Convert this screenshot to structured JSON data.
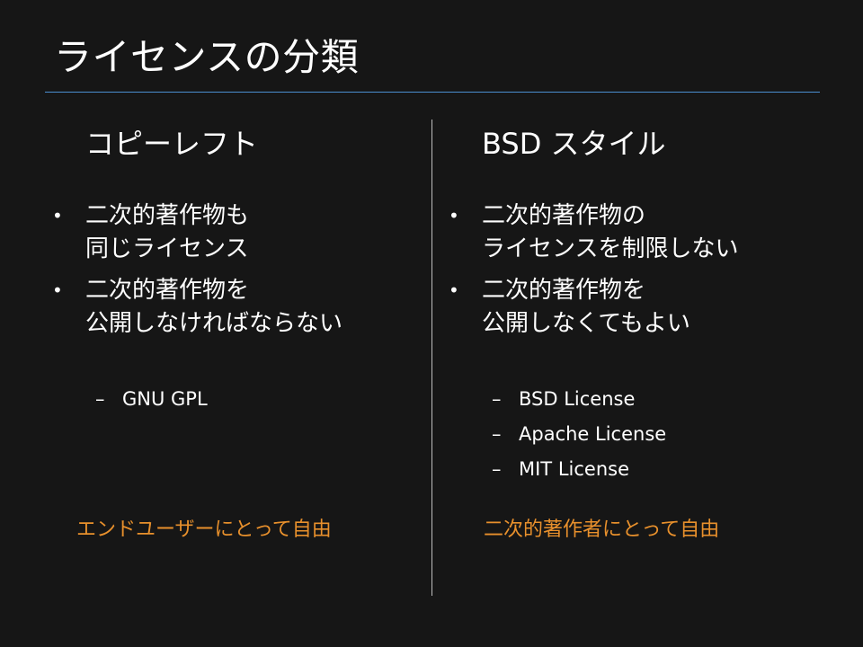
{
  "slide": {
    "title": "ライセンスの分類"
  },
  "columns": [
    {
      "heading": "コピーレフト",
      "bullets": [
        {
          "lines": [
            "二次的著作物も",
            "同じライセンス"
          ]
        },
        {
          "lines": [
            "二次的著作物を",
            "公開しなければならない"
          ]
        }
      ],
      "sub_items": [
        "GNU GPL"
      ],
      "note": "エンドユーザーにとって自由"
    },
    {
      "heading": "BSD スタイル",
      "bullets": [
        {
          "lines": [
            "二次的著作物の",
            "ライセンスを制限しない"
          ]
        },
        {
          "lines": [
            "二次的著作物を",
            "公開しなくてもよい"
          ]
        }
      ],
      "sub_items": [
        "BSD License",
        "Apache License",
        "MIT License"
      ],
      "note": "二次的著作者にとって自由"
    }
  ],
  "symbols": {
    "bullet": "•",
    "dash": "–"
  },
  "colors": {
    "background": "#161616",
    "text": "#ffffff",
    "accent": "#e8902c",
    "rule": "#4a8fd0"
  }
}
